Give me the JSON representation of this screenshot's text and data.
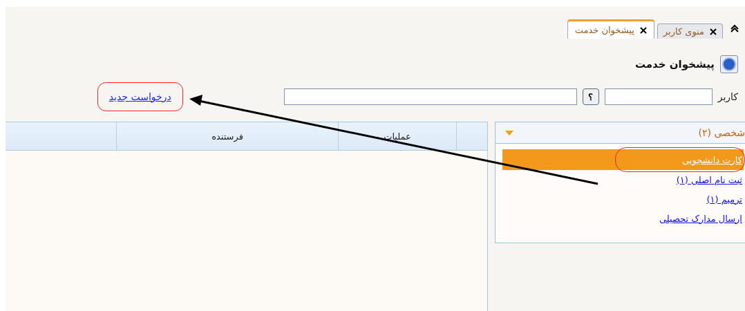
{
  "tabs": [
    {
      "label": "منوی کاربر",
      "selected": false
    },
    {
      "label": "پیشخوان خدمت",
      "selected": true
    }
  ],
  "page_title": "پیشخوان خدمت",
  "filter": {
    "label": "کاربر",
    "help_button": "؟"
  },
  "new_request_link": "درخواست جدید",
  "category": {
    "title": "شخصی (۲)",
    "expanded": true,
    "items": [
      {
        "label": "کارت دانشجویی",
        "selected": true
      },
      {
        "label": "ثبت نام اصلی (۱)",
        "selected": false
      },
      {
        "label": "ترمیم (۱)",
        "selected": false
      },
      {
        "label": "ارسال مدارک تحصیلی",
        "selected": false
      }
    ]
  },
  "table": {
    "columns": [
      "",
      "عملیات",
      "فرستنده",
      ""
    ]
  }
}
